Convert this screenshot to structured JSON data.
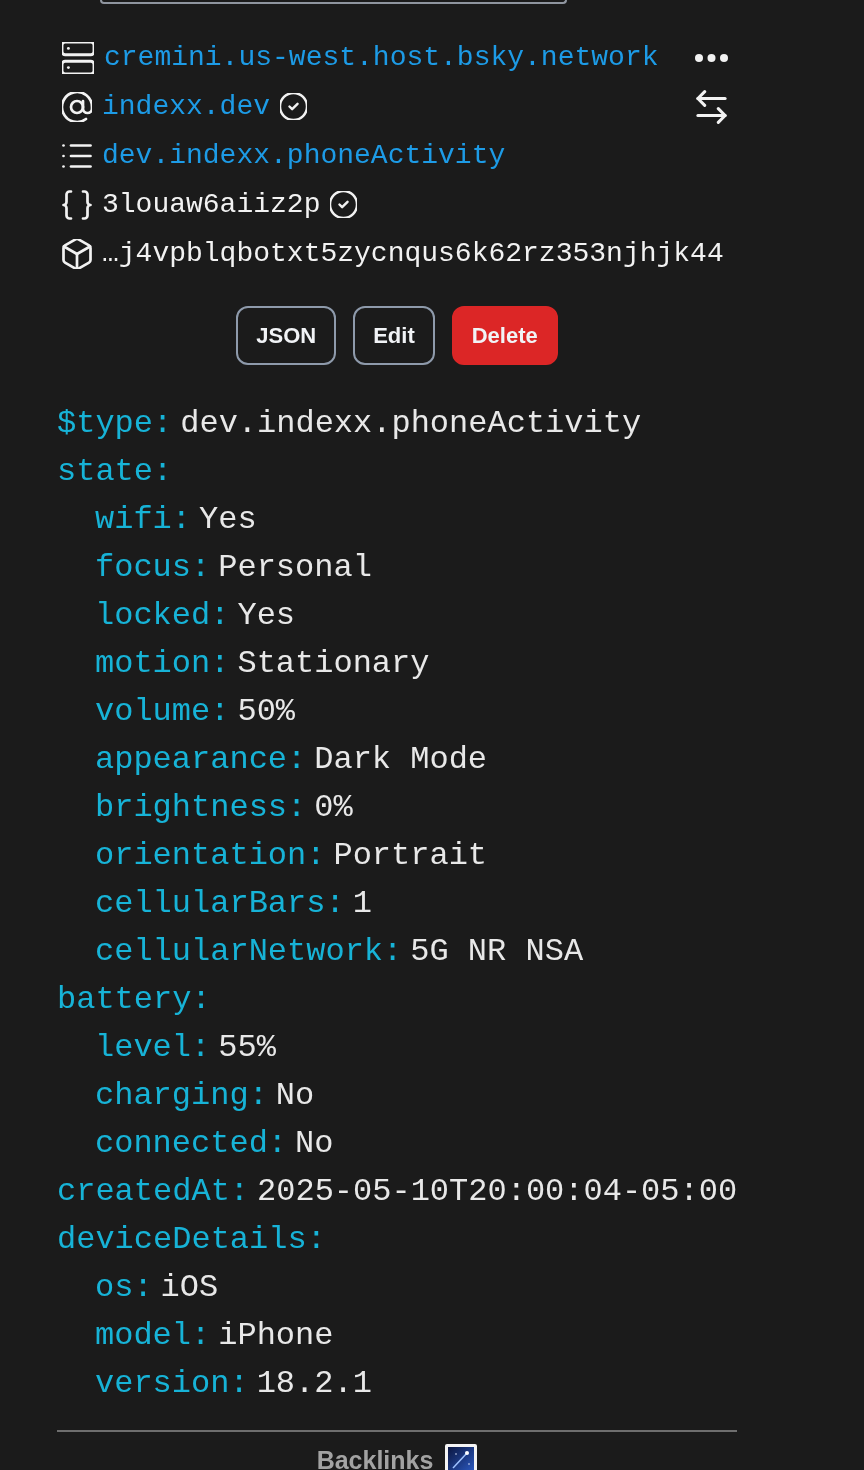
{
  "record_header": {
    "rows": [
      {
        "kind": "pds",
        "text": "cremini.us-west.host.bsky.network",
        "link": true,
        "verified": false
      },
      {
        "kind": "handle",
        "text": "indexx.dev",
        "link": true,
        "verified": true
      },
      {
        "kind": "collection",
        "text": "dev.indexx.phoneActivity",
        "link": true,
        "verified": false
      },
      {
        "kind": "rkey",
        "text": "3louaw6aiiz2p",
        "link": false,
        "verified": true
      },
      {
        "kind": "cid",
        "text": "…j4vpblqbotxt5zycnqus6k62rz353njhjk44",
        "link": false,
        "verified": false
      }
    ]
  },
  "buttons": [
    {
      "label": "JSON",
      "kind": "outline"
    },
    {
      "label": "Edit",
      "kind": "outline"
    },
    {
      "label": "Delete",
      "kind": "danger"
    }
  ],
  "record": [
    {
      "key": "$type:",
      "value": "dev.indexx.phoneActivity"
    },
    {
      "key": "state:",
      "children": [
        {
          "key": "wifi:",
          "value": "Yes"
        },
        {
          "key": "focus:",
          "value": "Personal"
        },
        {
          "key": "locked:",
          "value": "Yes"
        },
        {
          "key": "motion:",
          "value": "Stationary"
        },
        {
          "key": "volume:",
          "value": "50%"
        },
        {
          "key": "appearance:",
          "value": "Dark Mode"
        },
        {
          "key": "brightness:",
          "value": "0%"
        },
        {
          "key": "orientation:",
          "value": "Portrait"
        },
        {
          "key": "cellularBars:",
          "value": "1"
        },
        {
          "key": "cellularNetwork:",
          "value": "5G NR NSA"
        }
      ]
    },
    {
      "key": "battery:",
      "children": [
        {
          "key": "level:",
          "value": "55%"
        },
        {
          "key": "charging:",
          "value": "No"
        },
        {
          "key": "connected:",
          "value": "No"
        }
      ]
    },
    {
      "key": "createdAt:",
      "value": "2025-05-10T20:00:04-05:00"
    },
    {
      "key": "deviceDetails:",
      "children": [
        {
          "key": "os:",
          "value": "iOS"
        },
        {
          "key": "model:",
          "value": "iPhone"
        },
        {
          "key": "version:",
          "value": "18.2.1"
        }
      ]
    }
  ],
  "backlinks": {
    "title": "Backlinks"
  }
}
